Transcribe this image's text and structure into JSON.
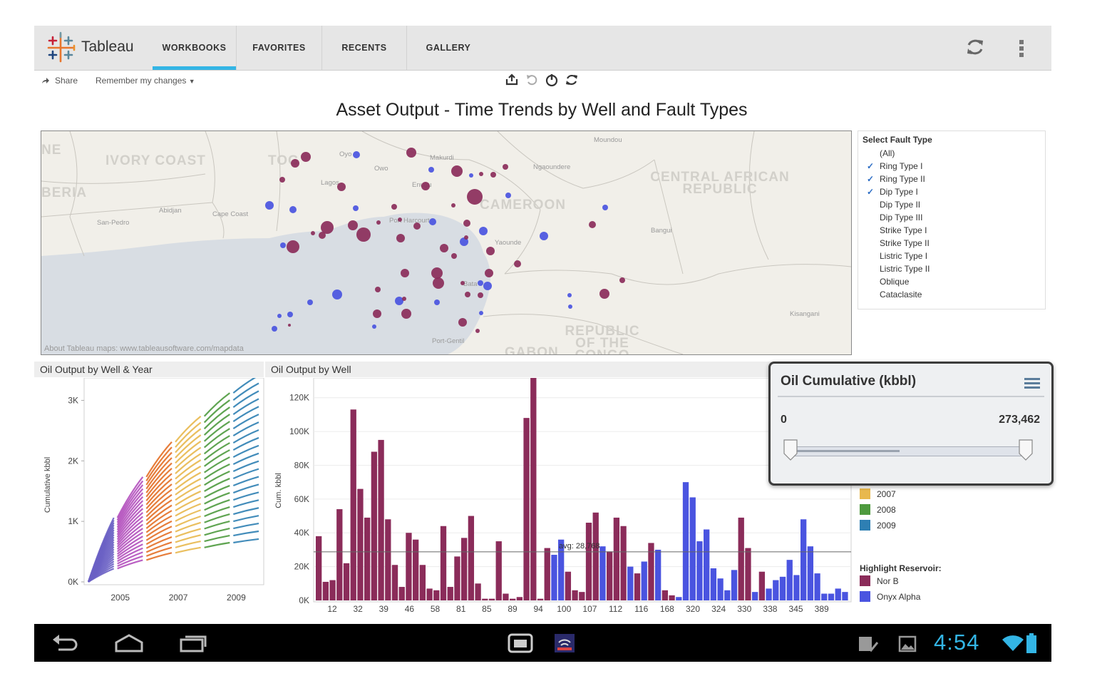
{
  "app": {
    "name": "Tableau"
  },
  "tabs": [
    {
      "label": "WORKBOOKS",
      "active": true
    },
    {
      "label": "FAVORITES",
      "active": false
    },
    {
      "label": "RECENTS",
      "active": false
    },
    {
      "label": "GALLERY",
      "active": false
    }
  ],
  "toolbar": {
    "share_label": "Share",
    "remember_label": "Remember my changes"
  },
  "dashboard": {
    "title": "Asset Output - Time Trends by Well and Fault Types"
  },
  "map": {
    "credit": "About Tableau maps: www.tableausoftware.com/mapdata",
    "countries": [
      "NE",
      "IVORY COAST",
      "TOG",
      "BERIA",
      "CAMEROON",
      "CENTRAL AFRICAN REPUBLIC",
      "REPUBLIC OF THE CONGO",
      "GABON"
    ],
    "cities": [
      "Abidjan",
      "Cape Coast",
      "San-Pedro",
      "Oyo",
      "Owo",
      "Makurdi",
      "Lagos",
      "Enugu",
      "Port Harcourt",
      "Ngaoundere",
      "Moundou",
      "Yaounde",
      "Bangui",
      "Bata",
      "Port-Gentil",
      "Kisangani"
    ],
    "colors": {
      "nor_b": "#8b2c5a",
      "onyx": "#4a54e0"
    }
  },
  "filter": {
    "title": "Select Fault Type",
    "items": [
      {
        "label": "(All)",
        "checked": false
      },
      {
        "label": "Ring Type I",
        "checked": true
      },
      {
        "label": "Ring Type II",
        "checked": true
      },
      {
        "label": "Dip Type I",
        "checked": true
      },
      {
        "label": "Dip Type II",
        "checked": false
      },
      {
        "label": "Dip Type III",
        "checked": false
      },
      {
        "label": "Strike Type I",
        "checked": false
      },
      {
        "label": "Strike Type II",
        "checked": false
      },
      {
        "label": "Listric Type I",
        "checked": false
      },
      {
        "label": "Listric Type II",
        "checked": false
      },
      {
        "label": "Oblique",
        "checked": false
      },
      {
        "label": "Cataclasite",
        "checked": false
      }
    ]
  },
  "line_chart": {
    "title": "Oil Output by Well & Year",
    "ylabel": "Cumulative kbbl",
    "yticks": [
      "3K",
      "2K",
      "1K",
      "0K"
    ],
    "ytick_values": [
      3000,
      2000,
      1000,
      0
    ],
    "xticks": [
      "2005",
      "2007",
      "2009"
    ],
    "year_colors": [
      "#6a61c4",
      "#b34fbd",
      "#e36f26",
      "#e8b84e",
      "#4e9a3e",
      "#2e7fb3"
    ]
  },
  "chart_data": {
    "type": "bar",
    "title": "Oil Output by Well",
    "ylabel": "Cum. kbbl",
    "ylim": [
      0,
      130000
    ],
    "yticks": [
      "120K",
      "100K",
      "80K",
      "60K",
      "40K",
      "20K",
      "0K"
    ],
    "ytick_values": [
      120000,
      100000,
      80000,
      60000,
      40000,
      20000,
      0
    ],
    "average": {
      "label": "avg: 28,768",
      "value": 28768
    },
    "x_tick_labels": [
      "12",
      "32",
      "39",
      "46",
      "58",
      "81",
      "85",
      "89",
      "94",
      "100",
      "107",
      "112",
      "116",
      "168",
      "320",
      "324",
      "330",
      "338",
      "345",
      "389"
    ],
    "values": [
      38000,
      11000,
      12000,
      54000,
      22000,
      113000,
      66000,
      49000,
      88000,
      95000,
      48000,
      21000,
      8000,
      40000,
      36000,
      21000,
      7000,
      6000,
      44000,
      8000,
      26000,
      37000,
      50000,
      10000,
      1000,
      1000,
      35000,
      4000,
      1000,
      2000,
      108000,
      132000,
      1000,
      31000,
      27000,
      36000,
      17000,
      6000,
      5000,
      46000,
      52000,
      32000,
      29000,
      49000,
      44000,
      20000,
      16000,
      23000,
      34000,
      30000,
      6000,
      3000,
      2000,
      70000,
      61000,
      35000,
      42000,
      19000,
      13000,
      6000,
      18000,
      49000,
      31000,
      5000,
      17000,
      7000,
      12000,
      14000,
      24000,
      15000,
      48000,
      32000,
      16000,
      4000,
      4000,
      7000,
      5000
    ],
    "reservoir": [
      "N",
      "N",
      "N",
      "N",
      "N",
      "N",
      "N",
      "N",
      "N",
      "N",
      "N",
      "N",
      "N",
      "N",
      "N",
      "N",
      "N",
      "N",
      "N",
      "N",
      "N",
      "N",
      "N",
      "N",
      "N",
      "N",
      "N",
      "N",
      "N",
      "N",
      "N",
      "N",
      "N",
      "N",
      "O",
      "O",
      "N",
      "N",
      "N",
      "N",
      "N",
      "O",
      "N",
      "N",
      "N",
      "O",
      "N",
      "O",
      "N",
      "O",
      "N",
      "N",
      "O",
      "O",
      "O",
      "O",
      "O",
      "O",
      "O",
      "O",
      "O",
      "N",
      "N",
      "O",
      "N",
      "O",
      "O",
      "O",
      "O",
      "O",
      "O",
      "O",
      "O",
      "O",
      "O",
      "O",
      "O"
    ]
  },
  "legend": {
    "years": [
      {
        "label": "2007",
        "color": "#e8b84e"
      },
      {
        "label": "2008",
        "color": "#4e9a3e"
      },
      {
        "label": "2009",
        "color": "#2e7fb3"
      }
    ],
    "highlight_title": "Highlight Reservoir:",
    "reservoirs": [
      {
        "label": "Nor B",
        "color": "#8b2c5a"
      },
      {
        "label": "Onyx Alpha",
        "color": "#4a54e0"
      }
    ]
  },
  "popup": {
    "title": "Oil Cumulative (kbbl)",
    "min": "0",
    "max": "273,462",
    "range_min": 0,
    "range_max": 273462
  },
  "statusbar": {
    "time": "4:54"
  }
}
